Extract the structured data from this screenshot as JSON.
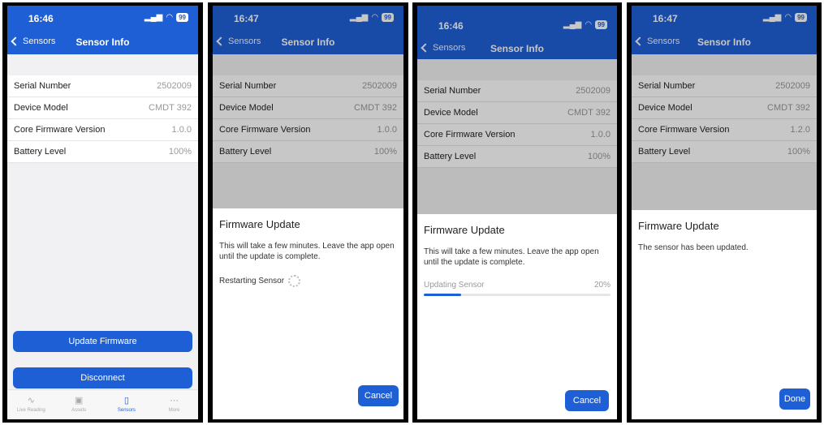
{
  "status": {
    "time_a": "16:46",
    "time_b": "16:47",
    "time_c": "16:46",
    "time_d": "16:47",
    "battery": "99"
  },
  "header": {
    "back_label": "Sensors",
    "title": "Sensor Info"
  },
  "info_rows": [
    {
      "label": "Serial Number",
      "value": "2502009"
    },
    {
      "label": "Device Model",
      "value": "CMDT 392"
    },
    {
      "label": "Core Firmware Version",
      "value": "1.0.0"
    },
    {
      "label": "Battery Level",
      "value": "100%"
    }
  ],
  "info_rows_after": [
    {
      "label": "Serial Number",
      "value": "2502009"
    },
    {
      "label": "Device Model",
      "value": "CMDT 392"
    },
    {
      "label": "Core Firmware Version",
      "value": "1.2.0"
    },
    {
      "label": "Battery Level",
      "value": "100%"
    }
  ],
  "buttons": {
    "update": "Update Firmware",
    "disconnect": "Disconnect",
    "cancel": "Cancel",
    "done": "Done"
  },
  "tabs": [
    {
      "label": "Live Reading",
      "icon": "pulse-icon"
    },
    {
      "label": "Assets",
      "icon": "assets-icon"
    },
    {
      "label": "Sensors",
      "icon": "sensor-icon"
    },
    {
      "label": "More",
      "icon": "more-icon"
    }
  ],
  "firmware": {
    "title": "Firmware Update",
    "message": "This will take a few minutes. Leave the app open until the update is complete.",
    "restarting": "Restarting Sensor",
    "updating": "Updating Sensor",
    "progress_label": "20%",
    "progress": 0.2,
    "done_message": "The sensor has been updated."
  }
}
